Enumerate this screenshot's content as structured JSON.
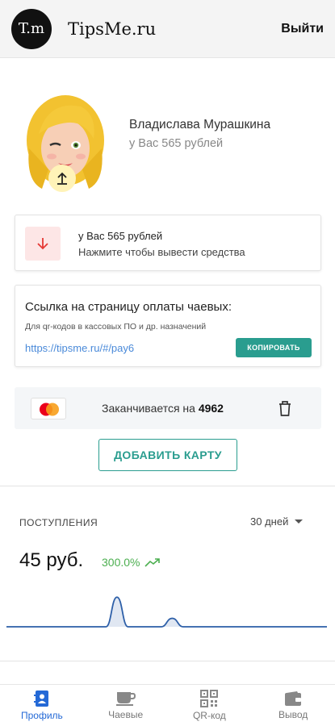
{
  "header": {
    "logo_text": "T.m",
    "brand": "TipsMe.ru",
    "logout_label": "Выйти"
  },
  "profile": {
    "name": "Владислава Мурашкина",
    "balance_text": "у Вас 565 рублей"
  },
  "withdraw": {
    "title": "у Вас 565 рублей",
    "subtitle": "Нажмите чтобы вывести средства"
  },
  "payment_link": {
    "title": "Ссылка на страницу оплаты чаевых:",
    "subtitle": "Для qr-кодов в кассовых ПО и др. назначений",
    "url": "https://tipsme.ru/#/pay6",
    "copy_label": "КОПИРОВАТЬ"
  },
  "bank_card": {
    "brand_icon": "mastercard-icon",
    "expires_prefix": "Заканчивается на",
    "last4": "4962"
  },
  "add_card_label": "ДОБАВИТЬ КАРТУ",
  "stats": {
    "title": "ПОСТУПЛЕНИЯ",
    "period": "30 дней",
    "amount": "45 руб.",
    "growth": "300.0%"
  },
  "chart_data": {
    "type": "area",
    "x": [
      1,
      2,
      3,
      4,
      5,
      6,
      7,
      8,
      9,
      10,
      11,
      12,
      13,
      14,
      15,
      16,
      17,
      18,
      19,
      20,
      21,
      22,
      23,
      24,
      25,
      26,
      27,
      28,
      29,
      30
    ],
    "values": [
      0,
      0,
      0,
      0,
      0,
      0,
      0,
      0,
      0,
      0,
      35,
      0,
      0,
      0,
      0,
      10,
      0,
      0,
      0,
      0,
      0,
      0,
      0,
      0,
      0,
      0,
      0,
      0,
      0,
      0
    ],
    "color": "#2d5fa8"
  },
  "nav": [
    {
      "label": "Профиль",
      "icon": "profile-icon",
      "active": true
    },
    {
      "label": "Чаевые",
      "icon": "cup-icon",
      "active": false
    },
    {
      "label": "QR-код",
      "icon": "qr-code-icon",
      "active": false
    },
    {
      "label": "Вывод",
      "icon": "wallet-icon",
      "active": false
    }
  ],
  "colors": {
    "accent": "#2a9d8f",
    "link": "#4a8ad9",
    "active_nav": "#2469d6",
    "growth": "#4caf50",
    "withdraw_bg": "#fde6e6",
    "withdraw_arrow": "#e53935"
  }
}
